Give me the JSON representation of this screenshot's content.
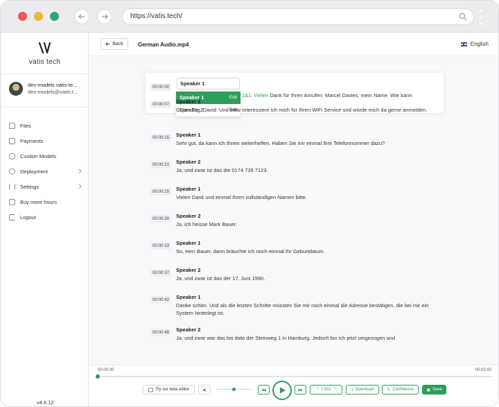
{
  "browser": {
    "url": "https://vatis.tech/",
    "colors": {
      "close": "#f0555a",
      "minimize": "#f3b63a",
      "maximize": "#2fa57a"
    }
  },
  "sidebar": {
    "logo_text": "vatis tech",
    "user": {
      "name": "dev-models vatis-te...",
      "email": "dev-models@vatis.t..."
    },
    "items": [
      {
        "label": "Files",
        "icon": "file-icon",
        "has_submenu": false
      },
      {
        "label": "Payments",
        "icon": "card-icon",
        "has_submenu": false
      },
      {
        "label": "Custom Models",
        "icon": "database-icon",
        "has_submenu": false
      },
      {
        "label": "Deployment",
        "icon": "globe-icon",
        "has_submenu": true
      },
      {
        "label": "Settings",
        "icon": "sliders-icon",
        "has_submenu": true
      },
      {
        "label": "Buy more hours",
        "icon": "cart-icon",
        "has_submenu": false
      },
      {
        "label": "Logout",
        "icon": "logout-icon",
        "has_submenu": false
      }
    ],
    "version": "v4.6.12"
  },
  "header": {
    "back_label": "Back",
    "file_name": "German Audio.mp4",
    "language": "English"
  },
  "editor": {
    "speaker_input_value": "Speaker 1",
    "dropdown": [
      {
        "label": "Speaker 1",
        "action": "Edit",
        "selected": true
      },
      {
        "label": "Speaker 2",
        "action": "Edit",
        "selected": false
      }
    ],
    "first_segment": {
      "timestamp": "00:00:00",
      "highlight": "1&1. Vielen",
      "text": " Dank für Ihren Anrufen. Marcel Davies, mein Name. Wie kann"
    }
  },
  "segments": [
    {
      "timestamp": "00:00:07",
      "speaker": "Speaker 2",
      "text": "Guten Tag, David. Und zwar interessiere ich mich für Ihren WiFi Service und würde mich da gerne anmelden."
    },
    {
      "timestamp": "00:00:15",
      "speaker": "Speaker 1",
      "text": "Sehr gut, da kann ich Ihnen weiterhelfen. Haben Sie mir einmal Ihre Telefonnummer dazu?"
    },
    {
      "timestamp": "00:00:21",
      "speaker": "Speaker 2",
      "text": "Ja, und zwar ist das die 0174 735 7123."
    },
    {
      "timestamp": "00:00:25",
      "speaker": "Speaker 1",
      "text": "Vielen Dank und einmal Ihren vollständigen Namen bitte."
    },
    {
      "timestamp": "00:00:30",
      "speaker": "Speaker 2",
      "text": "Ja, ich heisse Mark Bauer."
    },
    {
      "timestamp": "00:00:33",
      "speaker": "Speaker 1",
      "text": "So, Herr Bauer, dann bräuchte ich noch einmal Ihr Geburtdatum."
    },
    {
      "timestamp": "00:00:37",
      "speaker": "Speaker 2",
      "text": "Ja, und zwar ist das der 17. Juni 1990."
    },
    {
      "timestamp": "00:00:42",
      "speaker": "Speaker 1",
      "text": "Danke schön. Und als die letzten Schritte müssten Sie mir noch einmal die Adresse bestätigen, die bei mir ein System hinterlegt ist."
    },
    {
      "timestamp": "00:00:48",
      "speaker": "Speaker 2",
      "text": "Ja, und zwar war das bis dato der Steinweg 1 in Hamburg. Jedoch bin ich jetzt umgezogen und"
    }
  ],
  "player": {
    "current_time": "00:00:00",
    "duration": "00:02:43",
    "progress": 0,
    "volume": 0.5,
    "beta_label": "Try our beta editor",
    "speed": "1.00x",
    "download_label": "Download",
    "confidence_label": "Confidence",
    "save_label": "Save",
    "accent": "#2e9e5b"
  }
}
